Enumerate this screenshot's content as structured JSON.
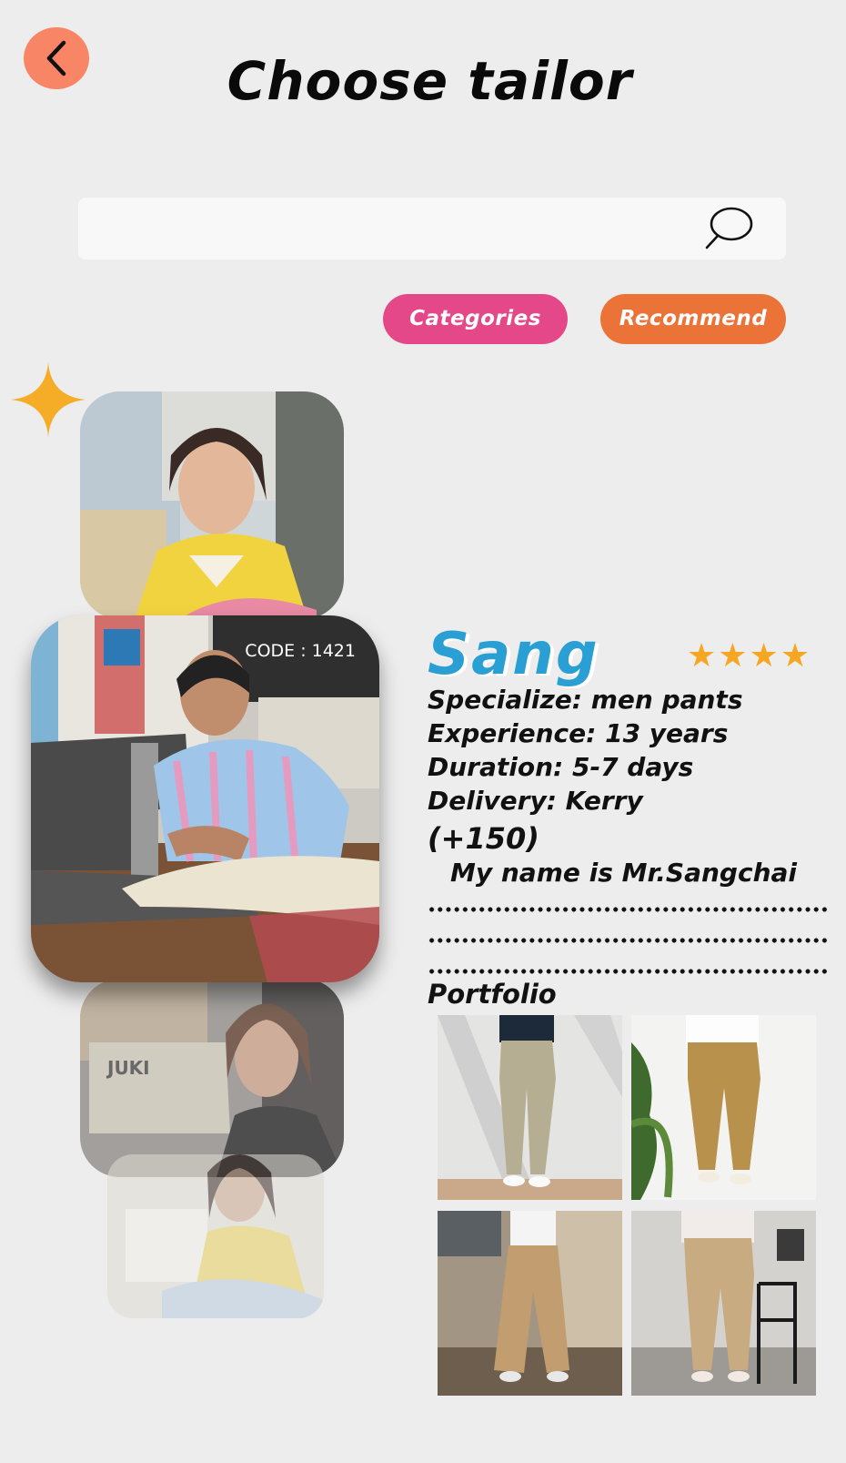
{
  "header": {
    "back_icon": "chevron-left-icon",
    "title": "Choose tailor"
  },
  "search": {
    "value": "",
    "placeholder": "",
    "icon": "search-icon"
  },
  "filters": {
    "categories_label": "Categories",
    "recommend_label": "Recommend"
  },
  "tailor_cards": {
    "main_code": "CODE : 1421"
  },
  "tailor": {
    "name": "Sang",
    "rating_stars": "★★★★",
    "rating_value": 4,
    "specialize": "Specialize: men pants",
    "experience": "Experience: 13 years",
    "duration": "Duration: 5-7 days",
    "delivery": "Delivery: Kerry",
    "delivery_fee": "(+150)",
    "intro": "My name is Mr.Sangchai"
  },
  "portfolio": {
    "title": "Portfolio"
  },
  "colors": {
    "background": "#ededed",
    "back_button": "#f78566",
    "categories": "#e44889",
    "recommend": "#ec7337",
    "name": "#2a9fd3",
    "stars": "#f5a623"
  }
}
